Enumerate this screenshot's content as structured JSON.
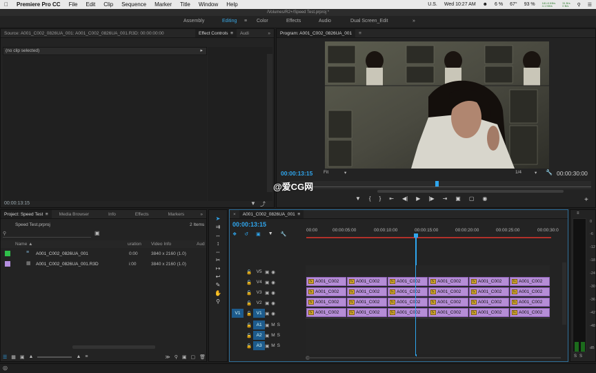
{
  "menubar": {
    "app": "Premiere Pro CC",
    "items": [
      "File",
      "Edit",
      "Clip",
      "Sequence",
      "Marker",
      "Title",
      "Window",
      "Help"
    ],
    "status": {
      "input": "U.S.",
      "clock": "Wed 10:27 AM",
      "stat1": "6 %",
      "stat2": "67°",
      "stat3": "93 %",
      "net1": "181.8 KB/s\n4.1 KB/s",
      "net2": "31 B/s\n0 B/s"
    }
  },
  "title": "/Volumes/R2+/Speed Test.prproj *",
  "workspaces": [
    "Assembly",
    "Editing",
    "Color",
    "Effects",
    "Audio",
    "Dual Screen_Edit"
  ],
  "source_panel": {
    "tabs": [
      "Source: A001_C002_0826UA_001: A001_C002_0826UA_001.R3D: 00:00:00:00",
      "Effect Controls",
      "Audi"
    ],
    "no_clip": "(no clip selected)",
    "timecode": "00:00:13:15"
  },
  "program": {
    "tab": "Program: A001_C002_0826UA_001",
    "timecode": "00:00:13:15",
    "fit": "Fit",
    "resolution": "1/4",
    "duration": "00:00:30:00"
  },
  "watermark": "@爱CG网",
  "project": {
    "tabs": [
      "Project: Speed Test",
      "Media Browser",
      "Info",
      "Effects",
      "Markers"
    ],
    "filename": "Speed Test.prproj",
    "count": "2 Items",
    "columns": [
      "Name",
      "uration",
      "Video Info",
      "Aud"
    ],
    "rows": [
      {
        "name": "A001_C002_0826UA_001",
        "duration": "0:00",
        "video": "3840 x 2160 (1.0)",
        "color": "#2fbf4a"
      },
      {
        "name": "A001_C002_0826UA_001.R3D",
        "duration": "i:00",
        "video": "3840 x 2160 (1.0)",
        "color": "#b48ee0"
      }
    ]
  },
  "timeline": {
    "tab": "A001_C002_0826UA_001",
    "timecode": "00:00:13:15",
    "ruler": [
      "00:00",
      "00:00:05:00",
      "00:00:10:00",
      "00:00:15:00",
      "00:00:20:00",
      "00:00:25:00",
      "00:00:30:0"
    ],
    "video_tracks": [
      "V5",
      "V4",
      "V3",
      "V2",
      "V1"
    ],
    "audio_tracks": [
      "A1",
      "A2",
      "A3"
    ],
    "clip_label": "A001_C002",
    "fx_label": "fx",
    "clip_label_v1": "A001_C002"
  },
  "meter": {
    "labels": [
      "0",
      "-6",
      "-12",
      "-18",
      "-24",
      "-30",
      "-36",
      "-42",
      "-48",
      "dB"
    ],
    "solo": [
      "S",
      "S"
    ]
  }
}
